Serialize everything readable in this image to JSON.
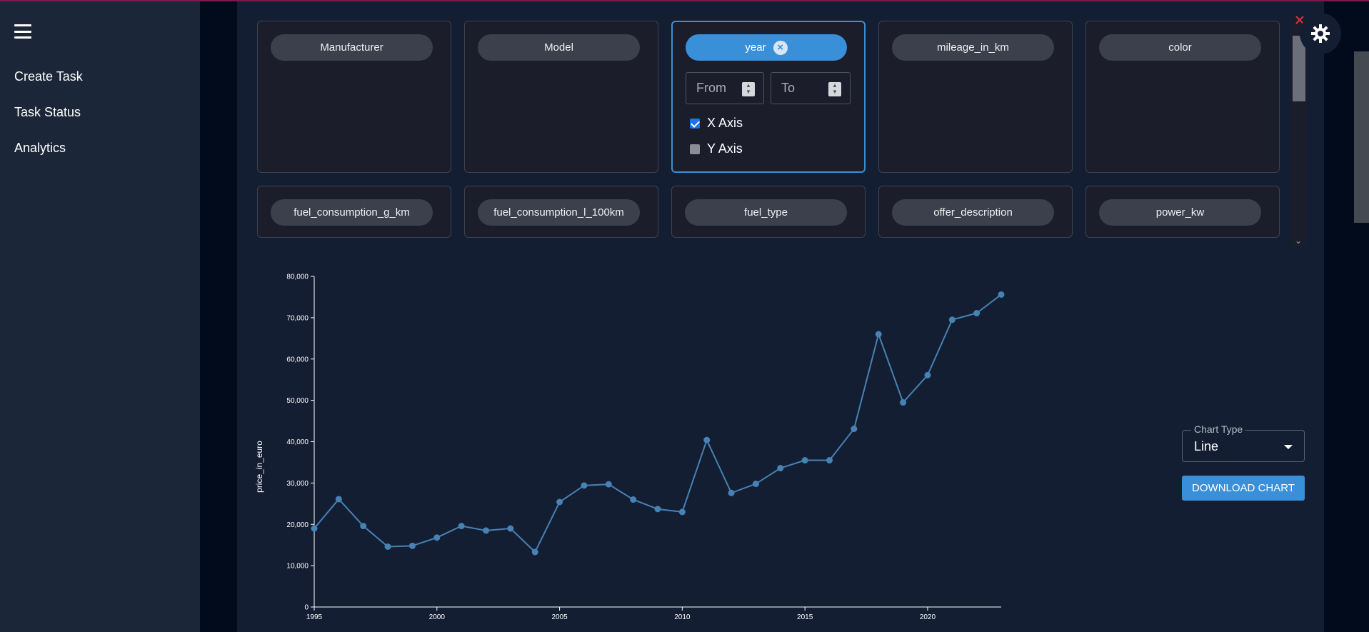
{
  "sidebar": {
    "menu_icon": "hamburger-menu-icon",
    "items": [
      {
        "label": "Create Task"
      },
      {
        "label": "Task Status"
      },
      {
        "label": "Analytics"
      }
    ]
  },
  "filters": {
    "row1": [
      {
        "label": "Manufacturer"
      },
      {
        "label": "Model"
      },
      {
        "label": "year"
      },
      {
        "label": "mileage_in_km"
      },
      {
        "label": "color"
      }
    ],
    "row2": [
      {
        "label": "fuel_consumption_g_km"
      },
      {
        "label": "fuel_consumption_l_100km"
      },
      {
        "label": "fuel_type"
      },
      {
        "label": "offer_description"
      },
      {
        "label": "power_kw"
      }
    ],
    "year_panel": {
      "from_placeholder": "From",
      "to_placeholder": "To",
      "x_axis_label": "X Axis",
      "y_axis_label": "Y Axis",
      "x_axis_checked": true,
      "y_axis_checked": false
    }
  },
  "controls": {
    "chart_type_legend": "Chart Type",
    "chart_type_value": "Line",
    "download_label": "DOWNLOAD CHART"
  },
  "colors": {
    "accent": "#3a8fd9",
    "line": "#4682b4",
    "sidebar_bg": "#1c2639",
    "main_bg": "#141e33"
  },
  "chart_data": {
    "type": "line",
    "title": "",
    "xlabel": "",
    "ylabel": "price_in_euro",
    "xlim": [
      1995,
      2023
    ],
    "ylim": [
      0,
      80000
    ],
    "x_ticks": [
      1995,
      2000,
      2005,
      2010,
      2015,
      2020
    ],
    "y_ticks": [
      0,
      10000,
      20000,
      30000,
      40000,
      50000,
      60000,
      70000,
      80000
    ],
    "y_tick_labels": [
      "0",
      "10,000",
      "20,000",
      "30,000",
      "40,000",
      "50,000",
      "60,000",
      "70,000",
      "80,000"
    ],
    "grid": false,
    "series": [
      {
        "x": [
          1995,
          1996,
          1997,
          1998,
          1999,
          2000,
          2001,
          2002,
          2003,
          2004,
          2005,
          2006,
          2007,
          2008,
          2009,
          2010,
          2011,
          2012,
          2013,
          2014,
          2015,
          2016,
          2017,
          2018,
          2019,
          2020,
          2021,
          2022,
          2023
        ],
        "values": [
          19000,
          26100,
          19600,
          14600,
          14800,
          16800,
          19600,
          18500,
          19000,
          13300,
          25400,
          29400,
          29700,
          26000,
          23700,
          23000,
          40400,
          27600,
          29800,
          33600,
          35500,
          35500,
          43100,
          66000,
          49500,
          56100,
          69500,
          71100,
          75600
        ]
      }
    ]
  }
}
